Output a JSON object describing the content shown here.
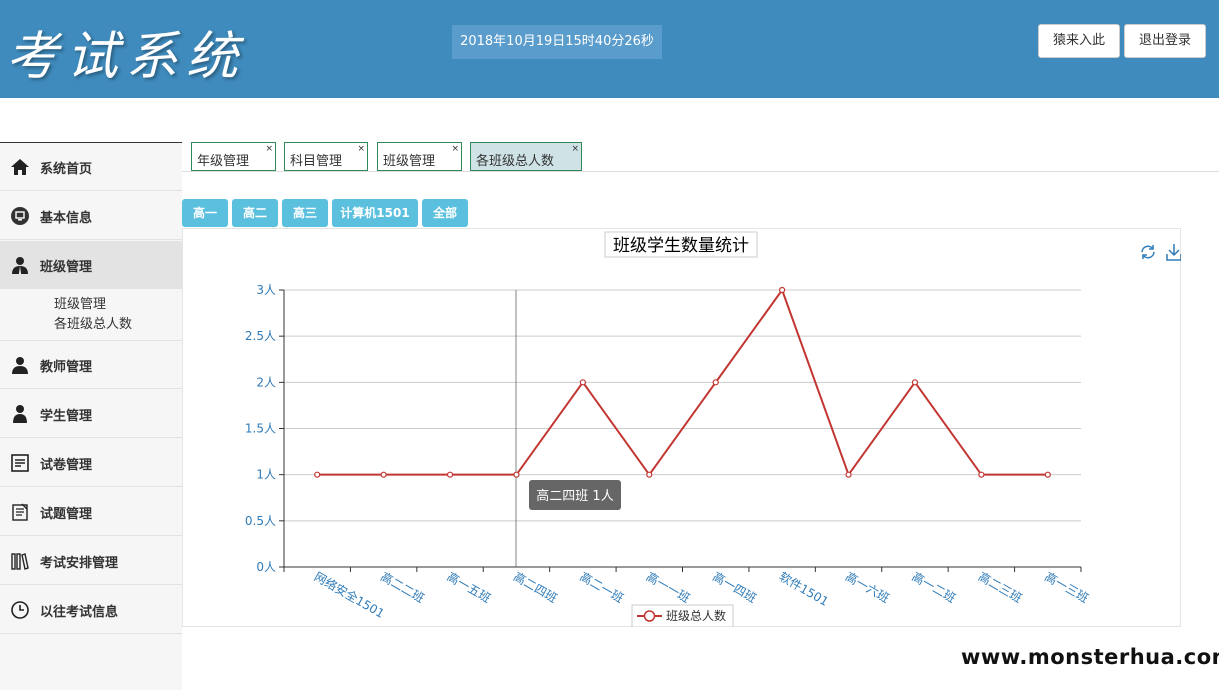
{
  "header": {
    "logo_text": "考试系统",
    "datetime": "2018年10月19日15时40分26秒",
    "buttons": [
      "猿来入此",
      "退出登录"
    ]
  },
  "sidebar": {
    "items": [
      {
        "label": "系统首页",
        "icon": "home-icon"
      },
      {
        "label": "基本信息",
        "icon": "monitor-icon"
      },
      {
        "label": "班级管理",
        "icon": "user-icon",
        "active": true,
        "children": [
          "班级管理",
          "各班级总人数"
        ]
      },
      {
        "label": "教师管理",
        "icon": "user-icon"
      },
      {
        "label": "学生管理",
        "icon": "user-icon"
      },
      {
        "label": "试卷管理",
        "icon": "document-icon"
      },
      {
        "label": "试题管理",
        "icon": "document-icon"
      },
      {
        "label": "考试安排管理",
        "icon": "books-icon"
      },
      {
        "label": "以往考试信息",
        "icon": "clock-icon"
      }
    ]
  },
  "tabs": [
    {
      "label": "年级管理",
      "close": "×"
    },
    {
      "label": "科目管理",
      "close": "×"
    },
    {
      "label": "班级管理",
      "close": "×"
    },
    {
      "label": "各班级总人数",
      "close": "×",
      "active": true
    }
  ],
  "filters": [
    "高一",
    "高二",
    "高三",
    "计算机1501",
    "全部"
  ],
  "tooltip": "高二四班 1人",
  "watermark": "www.monsterhua.com",
  "colors": {
    "header": "#3f8bbd",
    "accent": "#5bc0de",
    "line": "#c23531",
    "title": "#4b8bbe"
  },
  "chart_data": {
    "type": "line",
    "title": "班级学生数量统计",
    "categories": [
      "网络安全1501",
      "高二二班",
      "高一五班",
      "高二四班",
      "高二一班",
      "高一一班",
      "高一四班",
      "软件1501",
      "高一六班",
      "高一二班",
      "高二三班",
      "高一三班"
    ],
    "series": [
      {
        "name": "班级总人数",
        "values": [
          1,
          1,
          1,
          1,
          2,
          1,
          2,
          3,
          1,
          2,
          1,
          1
        ]
      }
    ],
    "yticks": [
      "0人",
      "0.5人",
      "1人",
      "1.5人",
      "2人",
      "2.5人",
      "3人"
    ],
    "ylim": [
      0,
      3
    ],
    "grid": true,
    "legend": "bottom-center"
  }
}
